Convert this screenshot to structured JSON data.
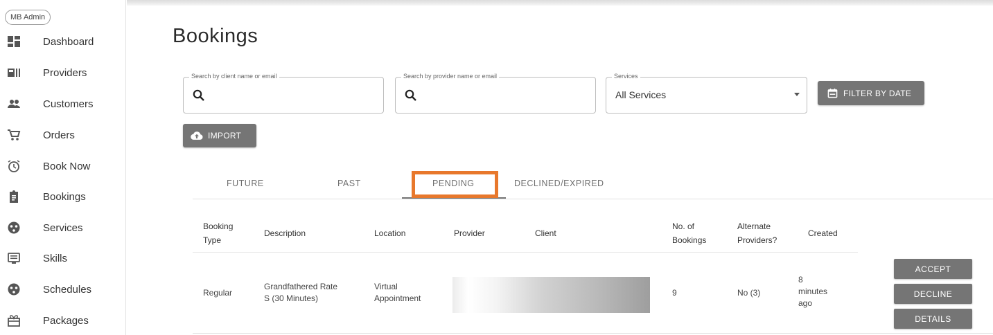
{
  "sidebar": {
    "role": "MB Admin",
    "items": [
      {
        "label": "Dashboard",
        "icon": "dashboard-icon"
      },
      {
        "label": "Providers",
        "icon": "providers-icon"
      },
      {
        "label": "Customers",
        "icon": "customers-icon"
      },
      {
        "label": "Orders",
        "icon": "cart-icon"
      },
      {
        "label": "Book Now",
        "icon": "alarm-icon"
      },
      {
        "label": "Bookings",
        "icon": "clipboard-icon"
      },
      {
        "label": "Services",
        "icon": "services-icon"
      },
      {
        "label": "Skills",
        "icon": "skills-icon"
      },
      {
        "label": "Schedules",
        "icon": "schedules-icon"
      },
      {
        "label": "Packages",
        "icon": "packages-icon"
      }
    ]
  },
  "page": {
    "title": "Bookings"
  },
  "filters": {
    "client_search": {
      "legend": "Search by client name or email",
      "value": ""
    },
    "provider_search": {
      "legend": "Search by provider name or email",
      "value": ""
    },
    "services": {
      "legend": "Services",
      "value": "All Services"
    },
    "filter_by_date_label": "FILTER BY DATE",
    "import_label": "IMPORT"
  },
  "tabs": [
    {
      "label": "FUTURE"
    },
    {
      "label": "PAST"
    },
    {
      "label": "PENDING",
      "active": true
    },
    {
      "label": "DECLINED/EXPIRED"
    }
  ],
  "table": {
    "headers": {
      "booking_type": [
        "Booking",
        "Type"
      ],
      "description": "Description",
      "location": "Location",
      "provider": "Provider",
      "client": "Client",
      "no_of_bookings": [
        "No. of",
        "Bookings"
      ],
      "alternate_providers": [
        "Alternate",
        "Providers?"
      ],
      "created": "Created"
    },
    "rows": [
      {
        "booking_type": "Regular",
        "description": [
          "Grandfathered Rate",
          "S (30 Minutes)"
        ],
        "location": [
          "Virtual",
          "Appointment"
        ],
        "no_of_bookings": "9",
        "alternate_providers": "No (3)",
        "created": [
          "8",
          "minutes",
          "ago"
        ],
        "actions": {
          "accept": "ACCEPT",
          "decline": "DECLINE",
          "details": "DETAILS"
        }
      }
    ]
  },
  "colors": {
    "highlight": "#e8782c",
    "button": "#757575"
  }
}
